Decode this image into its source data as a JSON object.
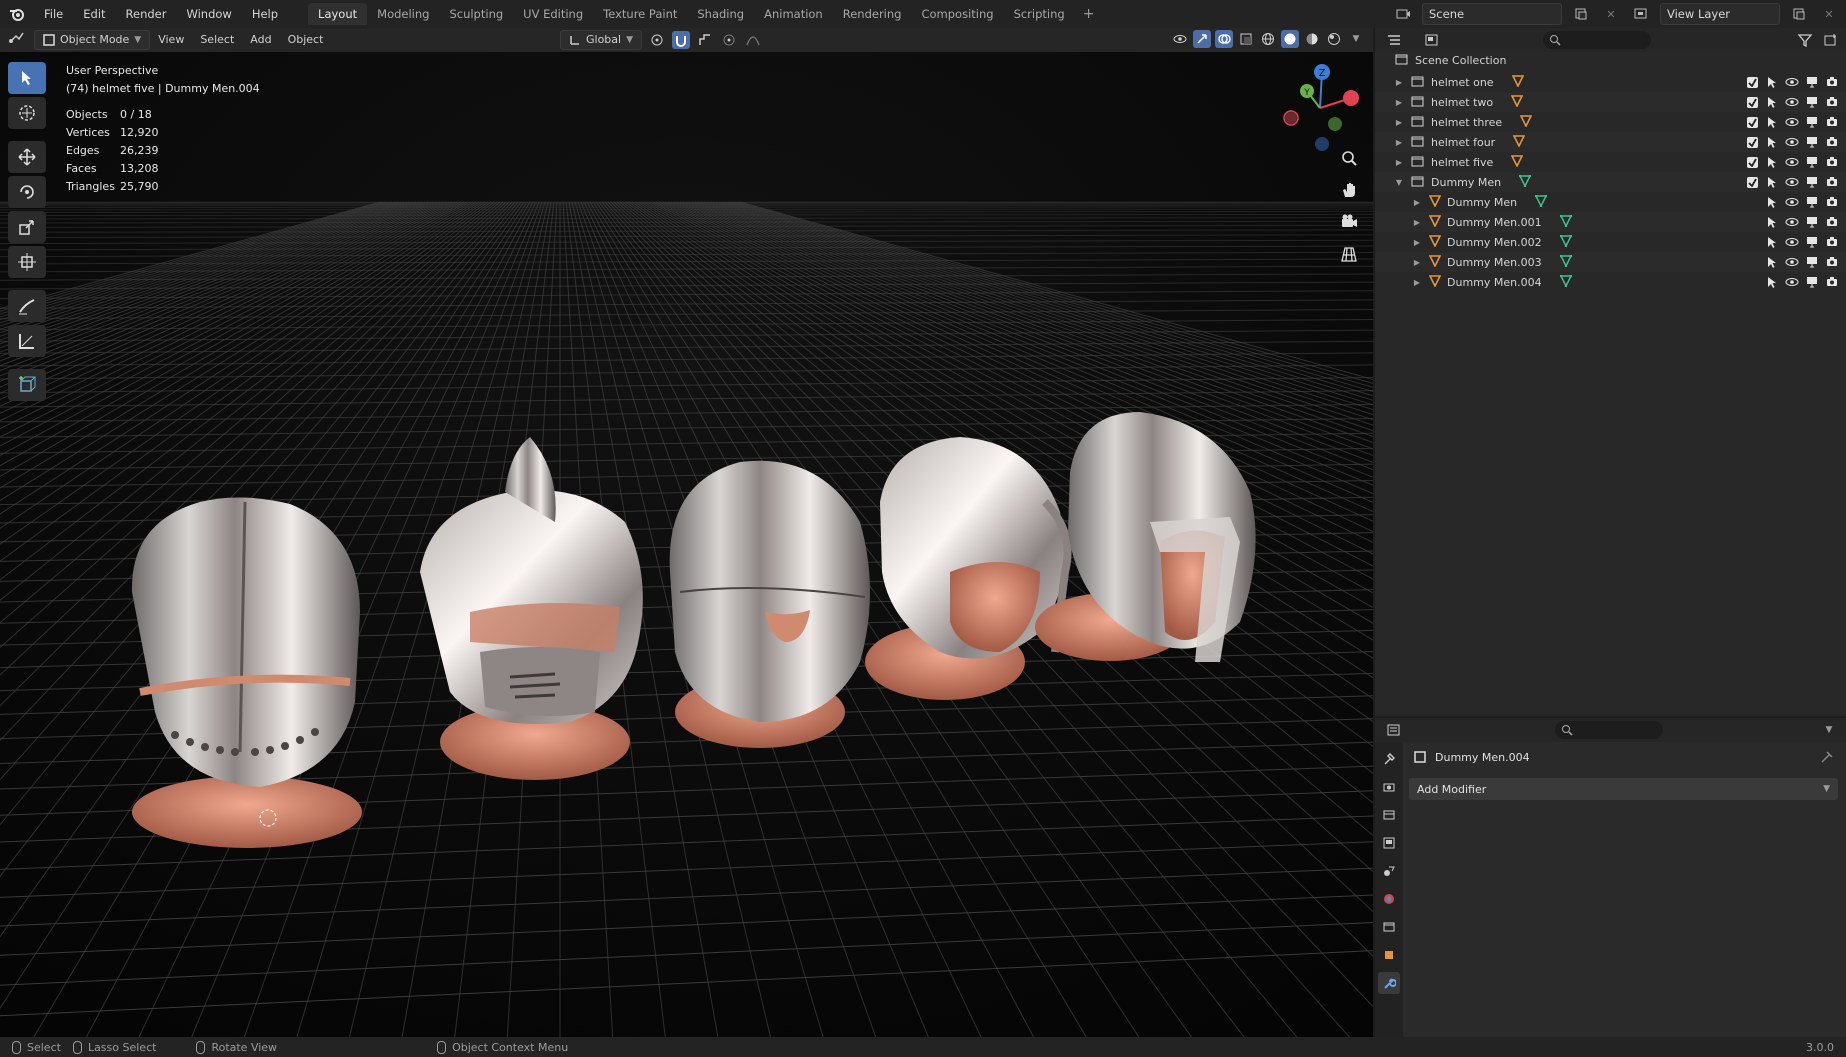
{
  "app": {
    "menu": [
      "File",
      "Edit",
      "Render",
      "Window",
      "Help"
    ],
    "workspace_tabs": [
      "Layout",
      "Modeling",
      "Sculpting",
      "UV Editing",
      "Texture Paint",
      "Shading",
      "Animation",
      "Rendering",
      "Compositing",
      "Scripting"
    ],
    "active_tab": "Layout",
    "scene_name": "Scene",
    "view_layer": "View Layer",
    "version": "3.0.0"
  },
  "viewport_header": {
    "mode": "Object Mode",
    "menus": [
      "View",
      "Select",
      "Add",
      "Object"
    ],
    "transform_orientation": "Global"
  },
  "viewport_overlay": {
    "perspective": "User Perspective",
    "context": "(74) helmet five | Dummy Men.004",
    "stats": [
      {
        "k": "Objects",
        "v": "0 / 18"
      },
      {
        "k": "Vertices",
        "v": "12,920"
      },
      {
        "k": "Edges",
        "v": "26,239"
      },
      {
        "k": "Faces",
        "v": "13,208"
      },
      {
        "k": "Triangles",
        "v": "25,790"
      }
    ]
  },
  "gizmo": {
    "x": "X",
    "y": "Y",
    "z": "Z"
  },
  "outliner": {
    "root": "Scene Collection",
    "rows": [
      {
        "label": "helmet one",
        "type": "collection"
      },
      {
        "label": "helmet two",
        "type": "collection"
      },
      {
        "label": "helmet three",
        "type": "collection"
      },
      {
        "label": "helmet four",
        "type": "collection"
      },
      {
        "label": "helmet five",
        "type": "collection"
      },
      {
        "label": "Dummy Men",
        "type": "collection"
      },
      {
        "label": "Dummy Men",
        "type": "object"
      },
      {
        "label": "Dummy Men.001",
        "type": "object"
      },
      {
        "label": "Dummy Men.002",
        "type": "object"
      },
      {
        "label": "Dummy Men.003",
        "type": "object"
      },
      {
        "label": "Dummy Men.004",
        "type": "object"
      }
    ]
  },
  "properties": {
    "object_name": "Dummy Men.004",
    "add_modifier": "Add Modifier"
  },
  "statusbar": {
    "select": "Select",
    "lasso": "Lasso Select",
    "rotate": "Rotate View",
    "context_menu": "Object Context Menu"
  },
  "colors": {
    "accent": "#4772b3",
    "orange": "#e8953a",
    "green": "#3ec28c",
    "axis_x": "#e0434f",
    "axis_y": "#6ab04c",
    "axis_z": "#3c7fd6",
    "copper": "#d98a70"
  }
}
